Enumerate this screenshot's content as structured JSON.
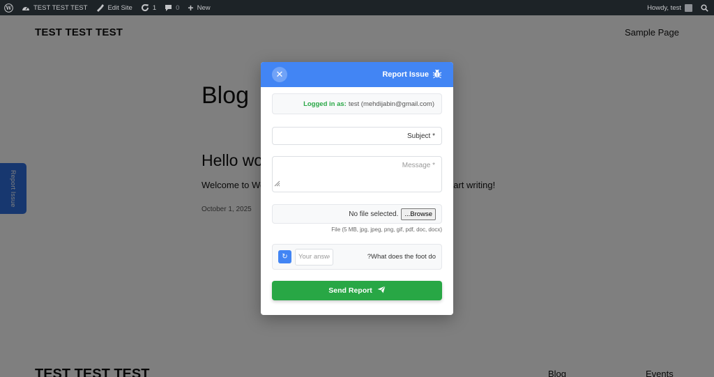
{
  "admin_bar": {
    "site_name": "TEST TEST TEST",
    "edit_site": "Edit Site",
    "updates_count": "1",
    "comments_count": "0",
    "new_label": "New",
    "howdy": "Howdy, test"
  },
  "site": {
    "title": "TEST TEST TEST",
    "nav_sample_page": "Sample Page"
  },
  "main": {
    "heading": "Blog",
    "post_title": "Hello wo",
    "post_excerpt_left": "Welcome to Wo",
    "post_excerpt_right": "n start writing!",
    "post_date": "October 1, 2025"
  },
  "footer": {
    "title": "TEST TEST TEST",
    "nav_blog": "Blog",
    "nav_events": "Events"
  },
  "side_tab": {
    "label": "Report Issue"
  },
  "modal": {
    "title": "Report Issue",
    "close_symbol": "✕",
    "logged_in_label": "Logged in as:",
    "logged_in_value": "test (mehdijabin@gmail.com)",
    "subject_placeholder": "* Subject",
    "message_placeholder": "* Message",
    "file_status": "No file selected.",
    "browse_label": "...Browse",
    "file_hint": "File (5 MB, jpg, jpeg, png, gif, pdf, doc, docx)",
    "refresh_symbol": "↻",
    "answer_placeholder": "Your answer",
    "captcha_question": "?What does the foot do",
    "send_label": "Send Report"
  },
  "colors": {
    "header_blue": "#4285f4",
    "send_green": "#28a745",
    "side_tab_blue": "#2f6fde",
    "admin_bar": "#1d2327"
  }
}
